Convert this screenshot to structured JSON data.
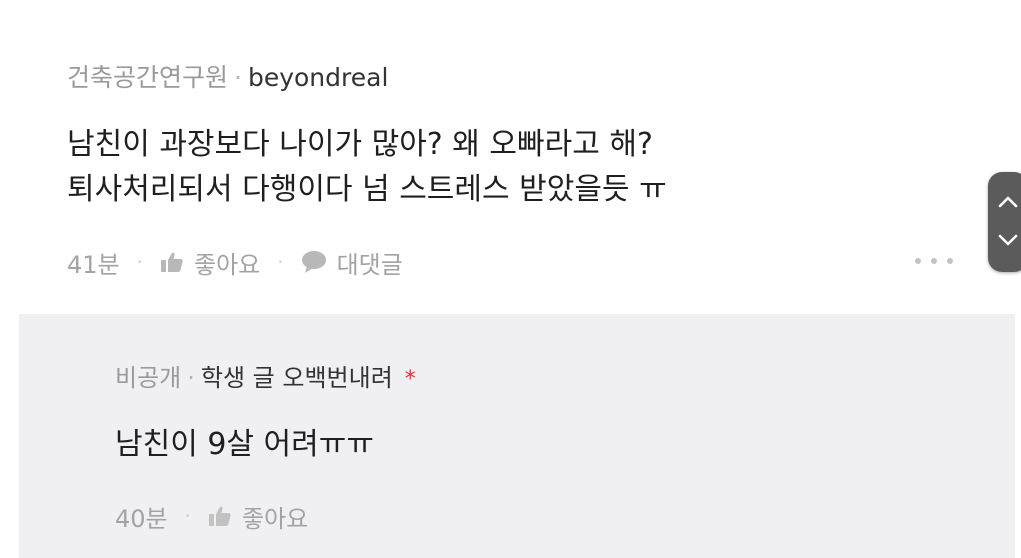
{
  "comment": {
    "author_org": "건축공간연구원",
    "separator": "·",
    "author_nick": "beyondreal",
    "line1": "남친이 과장보다 나이가 많아? 왜 오빠라고 해?",
    "line2": "퇴사처리되서 다행이다 넘 스트레스 받았을듯 ㅠ",
    "time": "41분",
    "like_label": "좋아요",
    "reply_label": "대댓글",
    "more_icon": "more-dots-icon"
  },
  "reply": {
    "author_org": "비공개",
    "separator": "·",
    "author_nick": "학생 글 오백번내려",
    "author_marker": "*",
    "text": "남친이 9살 어려ㅠㅠ",
    "time": "40분",
    "like_label": "좋아요"
  },
  "scroll_controls": {
    "up_icon": "chevron-up-icon",
    "down_icon": "chevron-down-icon"
  },
  "colors": {
    "reply_background": "#f0f0f3",
    "meta_gray": "#9a9a9a",
    "star_red": "#e8322f",
    "scroller": "#5b5b5b"
  }
}
